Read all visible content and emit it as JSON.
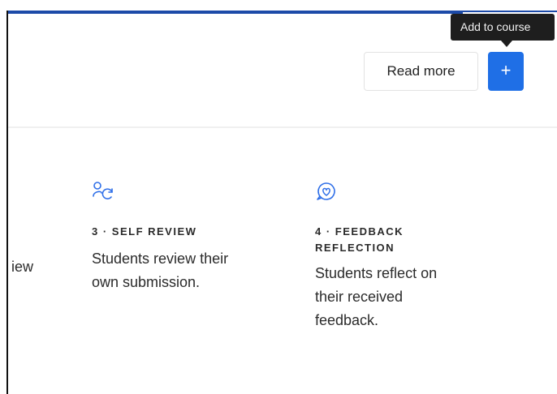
{
  "tooltip": {
    "text": "Add to course"
  },
  "header": {
    "read_more_label": "Read more",
    "add_label": "+"
  },
  "steps": [
    {
      "partial_text": "iew"
    },
    {
      "title": "3 · SELF REVIEW",
      "description_lines": [
        "Students review their",
        "own submission."
      ],
      "icon": "self-review-icon"
    },
    {
      "title_lines": [
        "4 · FEEDBACK",
        "REFLECTION"
      ],
      "description_lines": [
        "Students reflect on",
        "their received",
        "feedback."
      ],
      "icon": "feedback-reflection-icon"
    }
  ],
  "colors": {
    "accent": "#1f6fe6",
    "icon": "#2f6fe8",
    "top_bar": "#1c4aa8",
    "tooltip_bg": "#1e1e1e"
  }
}
